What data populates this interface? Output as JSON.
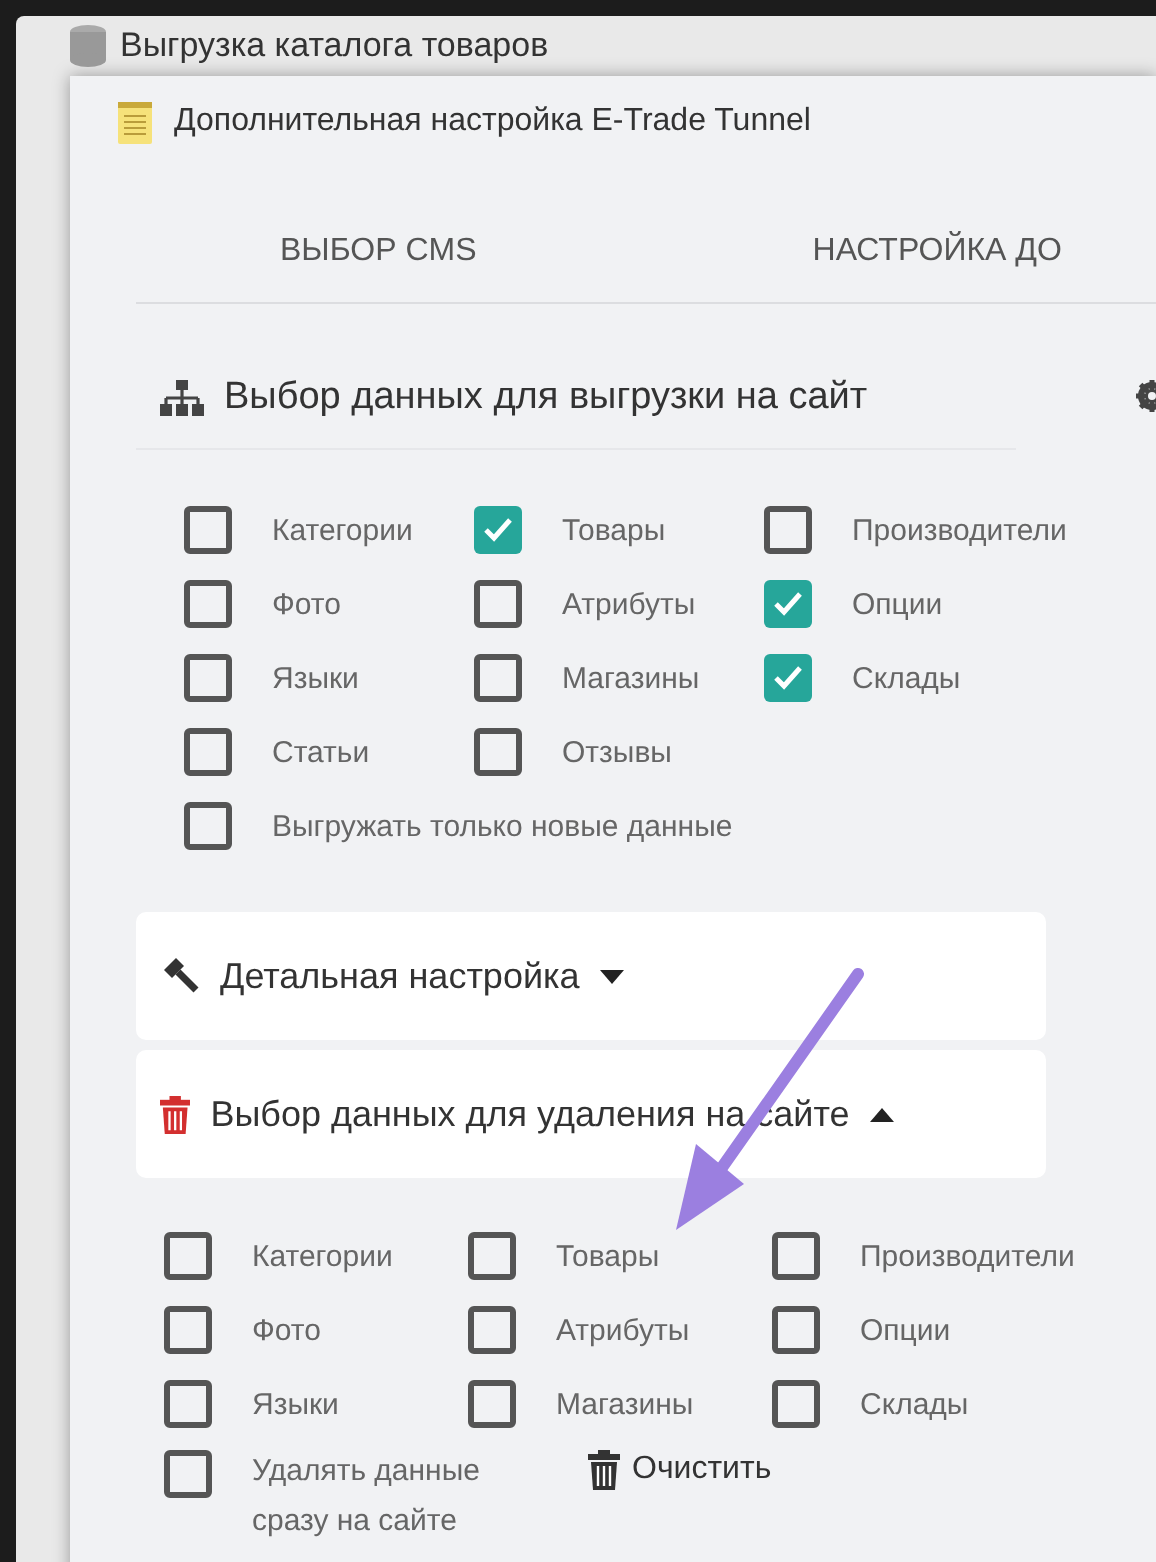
{
  "background_window": {
    "title": "Выгрузка каталога товаров"
  },
  "dialog": {
    "title": "Дополнительная настройка E-Trade Tunnel",
    "tabs": [
      {
        "label": "ВЫБОР CMS"
      },
      {
        "label": "НАСТРОЙКА ДО"
      }
    ],
    "export_section": {
      "title": "Выбор данных для выгрузки на сайт",
      "items": [
        {
          "label": "Категории",
          "checked": false
        },
        {
          "label": "Товары",
          "checked": true
        },
        {
          "label": "Производители",
          "checked": false
        },
        {
          "label": "Фото",
          "checked": false
        },
        {
          "label": "Атрибуты",
          "checked": false
        },
        {
          "label": "Опции",
          "checked": true
        },
        {
          "label": "Языки",
          "checked": false
        },
        {
          "label": "Магазины",
          "checked": false
        },
        {
          "label": "Склады",
          "checked": true
        },
        {
          "label": "Статьи",
          "checked": false
        },
        {
          "label": "Отзывы",
          "checked": false
        }
      ],
      "only_new": {
        "label": "Выгружать только новые данные",
        "checked": false
      }
    },
    "detail_panel": {
      "title": "Детальная настройка",
      "expanded": false
    },
    "delete_panel": {
      "title": "Выбор данных для удаления на сайте",
      "expanded": true,
      "items": [
        {
          "label": "Категории",
          "checked": false
        },
        {
          "label": "Товары",
          "checked": false
        },
        {
          "label": "Производители",
          "checked": false
        },
        {
          "label": "Фото",
          "checked": false
        },
        {
          "label": "Атрибуты",
          "checked": false
        },
        {
          "label": "Опции",
          "checked": false
        },
        {
          "label": "Языки",
          "checked": false
        },
        {
          "label": "Магазины",
          "checked": false
        },
        {
          "label": "Склады",
          "checked": false
        }
      ],
      "delete_now": {
        "label": "Удалять данные сразу на сайте",
        "checked": false
      },
      "clear_button": {
        "label": "Очистить"
      }
    }
  }
}
